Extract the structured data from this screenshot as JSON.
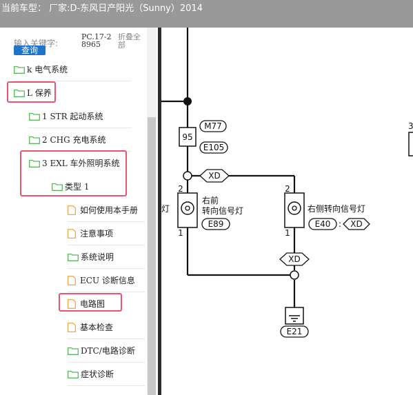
{
  "header": {
    "title": "当前车型： 厂家:D-东风日产阳光（Sunny）2014"
  },
  "search": {
    "label": "输入关键字:",
    "button": "查询",
    "code": "PC.17-28965",
    "collapse_all": "折叠全部"
  },
  "tree": [
    {
      "label": "k 电气系统",
      "kind": "folder"
    },
    {
      "label": "L 保养",
      "kind": "folder"
    },
    {
      "label": "1 STR 起动系统",
      "kind": "folder"
    },
    {
      "label": "2 CHG 充电系统",
      "kind": "folder"
    },
    {
      "label": "3 EXL 车外照明系统",
      "kind": "folder"
    },
    {
      "label": "类型 1",
      "kind": "folder"
    },
    {
      "label": "如何使用本手册",
      "kind": "file"
    },
    {
      "label": "注意事项",
      "kind": "file"
    },
    {
      "label": "系统说明",
      "kind": "folder"
    },
    {
      "label": "ECU 诊断信息",
      "kind": "file"
    },
    {
      "label": "电路图",
      "kind": "file"
    },
    {
      "label": "基本检查",
      "kind": "file"
    },
    {
      "label": "DTC/电路诊断",
      "kind": "folder"
    },
    {
      "label": "症状诊断",
      "kind": "folder"
    }
  ],
  "diagram": {
    "connector_m77": "M77",
    "pin_95": "95",
    "connector_e105": "E105",
    "label_xd_top": "XD",
    "pin_2_left": "2",
    "pin_1_left": "1",
    "pin_2_right": "2",
    "pin_1_right": "1",
    "lamp_front_line1": "右前",
    "lamp_front_line2": "转向信号灯",
    "connector_e89": "E89",
    "lamp_side": "右侧转向信号灯",
    "connector_e40": "E40",
    "label_xd_e40": "XD",
    "label_xd_mid": "XD",
    "connector_e21": "E21",
    "cut_left": "灯",
    "cut_right": "3"
  },
  "colors": {
    "titlebar": "#999999",
    "highlight": "#e85570",
    "button": "#1f74c9",
    "folder": "#5cb85c",
    "file": "#e8a23c"
  }
}
